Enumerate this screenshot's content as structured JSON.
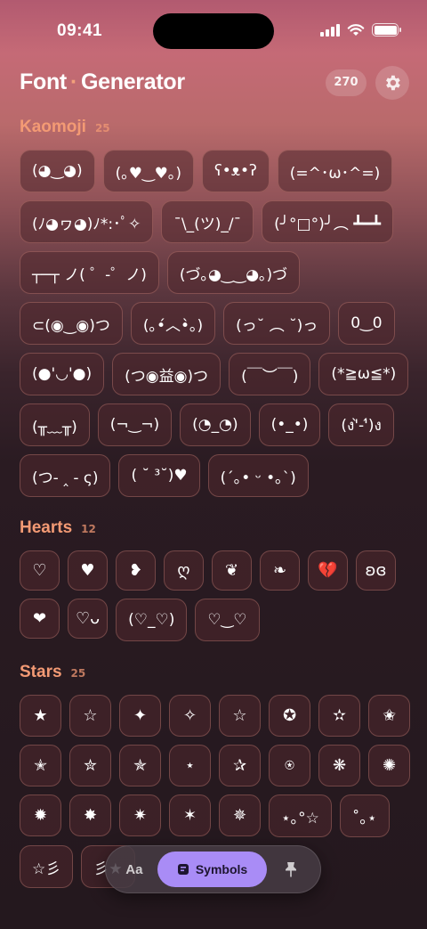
{
  "status": {
    "time": "09:41"
  },
  "header": {
    "title_part1": "Font",
    "title_dot": "·",
    "title_part2": "Generator",
    "count": "270",
    "settings_icon": "gear-icon"
  },
  "sections": {
    "kaomoji": {
      "title": "Kaomoji",
      "count": "25",
      "items": [
        "(◕‿◕)",
        "(｡♥‿♥｡)",
        "ʕ•ᴥ•ʔ",
        "(=^･ω･^=)",
        "(ﾉ◕ヮ◕)ﾉ*:･ﾟ✧",
        "¯\\_(ツ)_/¯",
        "(╯°□°)╯︵ ┻━┻",
        "┬─┬ ノ( ゜-゜ノ)",
        "(づ｡◕‿‿◕｡)づ",
        "⊂(◉‿◉)つ",
        "(｡•́︿•̀｡)",
        "(っ˘ ︵ ˘)っ",
        "0‿0",
        "(●'◡'●)",
        "(つ◉益◉)つ",
        "(￣︶￣)",
        "(*≧ω≦*)",
        "(╥﹏╥)",
        "(¬‿¬)",
        "(◔_◔)",
        "(•_•)",
        "(ง'̀-'́)ง",
        "(つ- ‸ - ς)",
        "( ˘ ³˘)♥",
        "(´｡• ᵕ •｡`)"
      ]
    },
    "hearts": {
      "title": "Hearts",
      "count": "12",
      "items": [
        "♡",
        "♥",
        "❥",
        "ღ",
        "❦",
        "❧",
        "💔",
        "ʚɞ",
        "❤",
        "♡ᴗ",
        "(♡_♡)",
        "♡‿♡"
      ]
    },
    "stars": {
      "title": "Stars",
      "count": "25",
      "items": [
        "★",
        "☆",
        "✦",
        "✧",
        "☆",
        "✪",
        "✫",
        "✬",
        "✭",
        "✮",
        "✯",
        "⋆",
        "✰",
        "⍟",
        "❋",
        "✺",
        "✹",
        "✸",
        "✷",
        "✶",
        "✵",
        "⋆｡°☆",
        "˚｡⋆",
        "☆彡",
        "彡★"
      ]
    }
  },
  "dock": {
    "text_tab": "Aa",
    "symbols_tab": "Symbols",
    "pin_icon": "pin-icon"
  },
  "colors": {
    "accent": "#f39a74",
    "active_tab": "#a98cf6"
  }
}
